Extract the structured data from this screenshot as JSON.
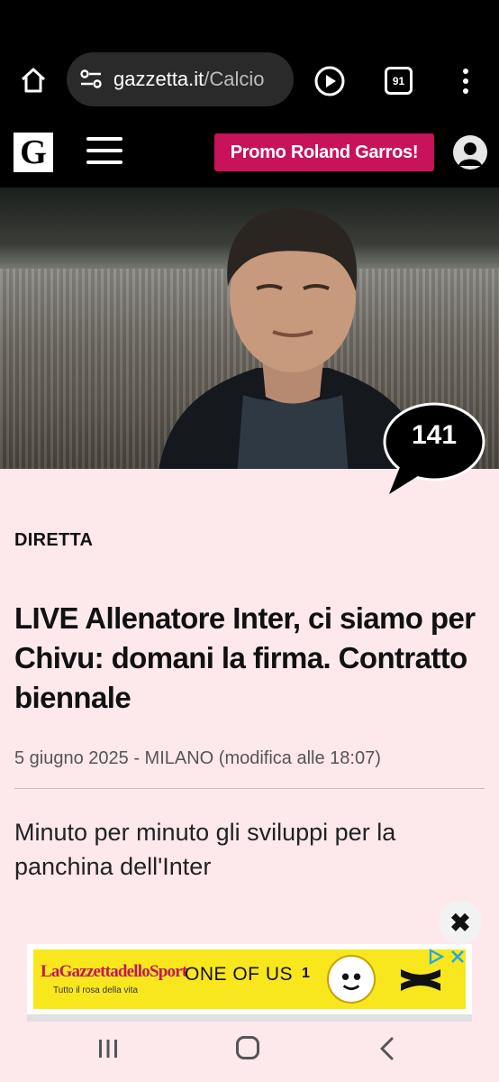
{
  "browser": {
    "url_host": "gazzetta.it",
    "url_path": "/Calcio",
    "tab_count": "91"
  },
  "site": {
    "logo_letter": "G",
    "promo_label": "Promo Roland Garros!"
  },
  "hero": {
    "comment_count": "141"
  },
  "article": {
    "kicker": "DIRETTA",
    "headline": "LIVE Allenatore Inter, ci siamo per Chivu: domani la firma. Contratto biennale",
    "dateline": "5 giugno 2025 - MILANO (modifica alle 18:07)",
    "summary": "Minuto per minuto gli sviluppi per la panchina dell'Inter"
  },
  "ad": {
    "close_label": "✖",
    "brand": "LaGazzettadelloSport",
    "tagline": "Tutto il rosa della vita",
    "product": "ONE OF US",
    "issue": "1",
    "colors": {
      "background": "#f8e71c",
      "brand": "#c2185b"
    }
  },
  "colors": {
    "accent": "#c8125a",
    "page_background": "#fde8ec",
    "header_background": "#000000"
  }
}
